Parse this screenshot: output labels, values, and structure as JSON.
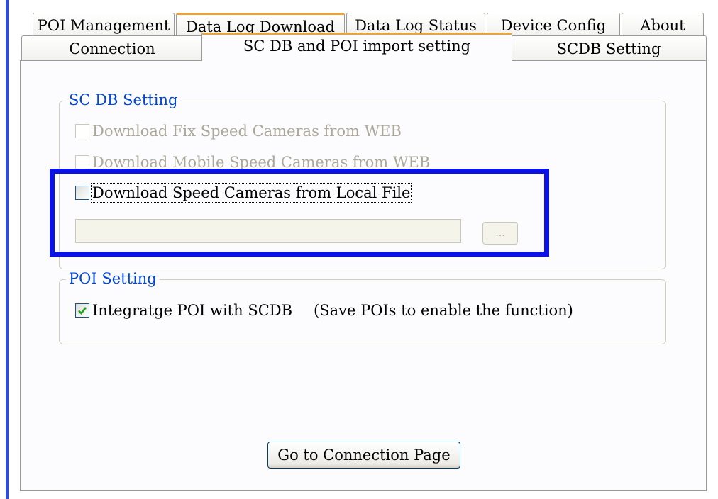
{
  "tabs_row1": [
    {
      "label": "POI Management"
    },
    {
      "label": "Data Log Download"
    },
    {
      "label": "Data Log Status"
    },
    {
      "label": "Device Config"
    },
    {
      "label": "About"
    }
  ],
  "tabs_row2": [
    {
      "label": "Connection"
    },
    {
      "label": "SC DB and POI import setting"
    },
    {
      "label": "SCDB  Setting"
    }
  ],
  "sc_db_group": {
    "legend": "SC DB  Setting",
    "fix_cameras": {
      "label": "Download Fix Speed Cameras from WEB",
      "checked": false,
      "enabled": false
    },
    "mobile_cameras": {
      "label": "Download Mobile Speed Cameras from WEB",
      "checked": false,
      "enabled": false
    },
    "local_file": {
      "label": "Download  Speed Cameras from Local File",
      "checked": false,
      "enabled": true
    },
    "file_path": {
      "value": ""
    },
    "browse_label": "..."
  },
  "poi_group": {
    "legend": "POI Setting",
    "integrate": {
      "label": "Integratge  POI with  SCDB",
      "checked": true
    },
    "note": "(Save POIs to enable the function)"
  },
  "go_button_label": "Go to Connection Page",
  "colors": {
    "highlight": "#0a12e6",
    "legend": "#0046d5",
    "tab_hot": "#e8a33a",
    "check": "#21a121"
  }
}
